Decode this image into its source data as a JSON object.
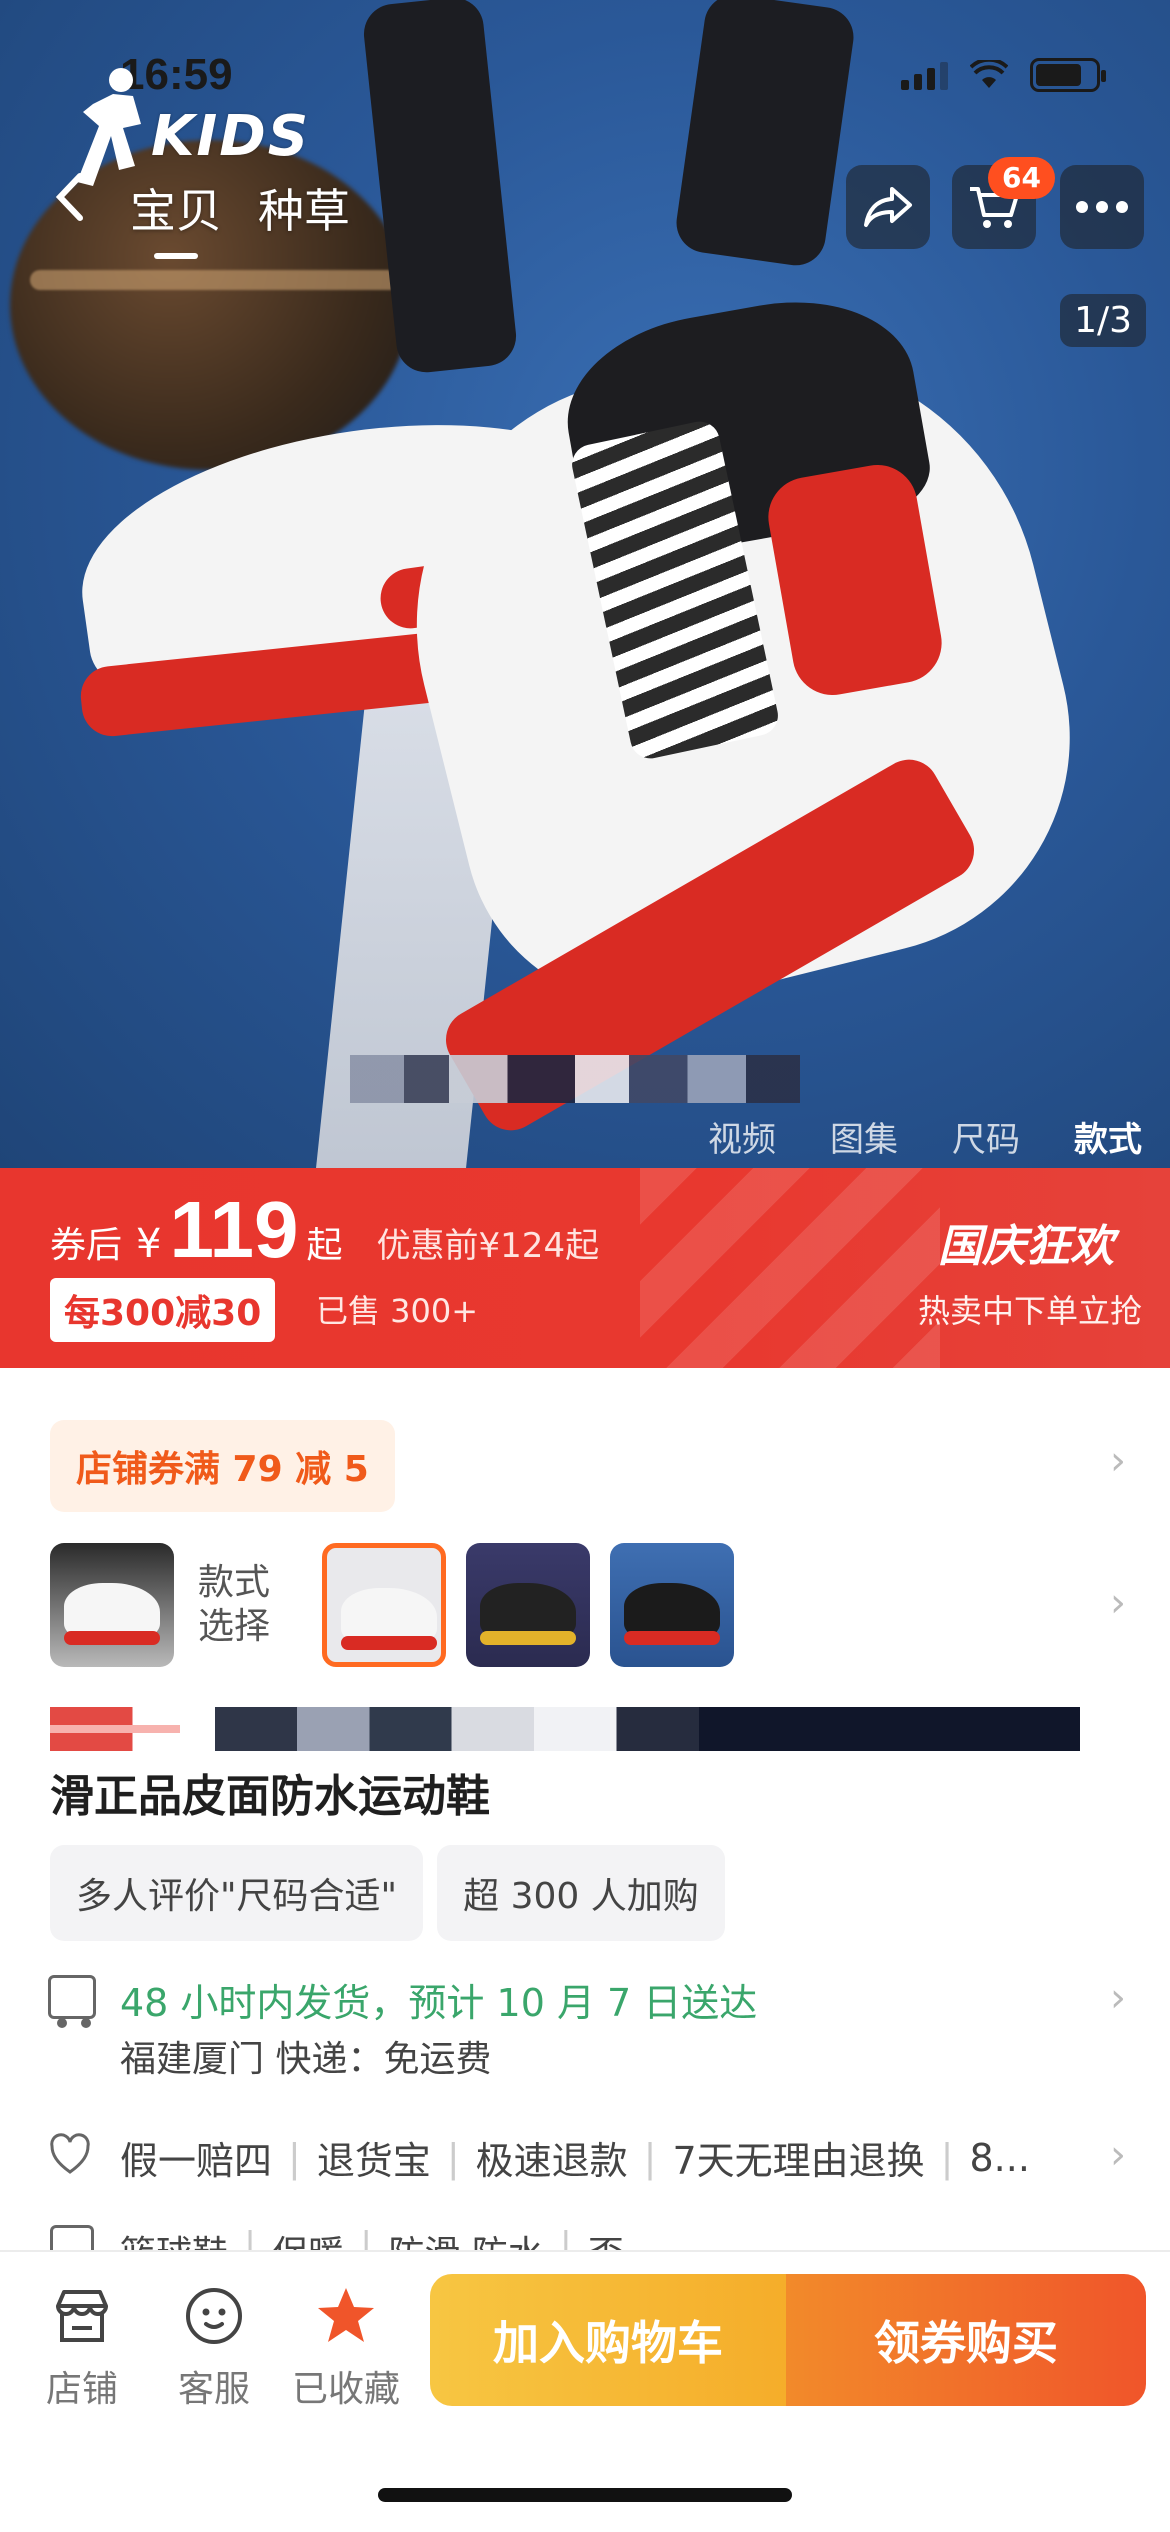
{
  "status_bar": {
    "time": "16:59"
  },
  "brand": {
    "logo_text": "KIDS"
  },
  "nav": {
    "back_icon": "chevron-left-icon",
    "tabs": [
      {
        "label": "宝贝",
        "active": true
      },
      {
        "label": "种草",
        "active": false
      }
    ],
    "cart_badge": "64",
    "share_icon": "share-arrow-icon",
    "cart_icon": "cart-icon",
    "more_icon": "more-dots-icon"
  },
  "gallery": {
    "pager": "1/3",
    "media_tabs": [
      {
        "label": "视频",
        "active": false
      },
      {
        "label": "图集",
        "active": false
      },
      {
        "label": "尺码",
        "active": false
      },
      {
        "label": "款式",
        "active": true
      }
    ]
  },
  "price": {
    "prefix": "券后",
    "currency": "¥",
    "value": "119",
    "suffix": "起",
    "original": "优惠前¥124起",
    "promo_tag": "每300减30",
    "sold": "已售 300+",
    "event_title": "国庆狂欢",
    "event_sub": "热卖中下单立抢"
  },
  "coupon": {
    "label": "店铺券满 79 减 5"
  },
  "variants": {
    "label": "款式选择",
    "count": 4,
    "selected_index": 1
  },
  "product": {
    "title": "滑正品皮面防水运动鞋"
  },
  "tags": [
    "多人评价\"尺码合适\"",
    "超 300 人加购"
  ],
  "shipping": {
    "main": "48 小时内发货，预计 10 月 7 日送达",
    "sub": "福建厦门  快递：免运费"
  },
  "guarantees": [
    "假一赔四",
    "退货宝",
    "极速退款",
    "7天无理由退换",
    "8..."
  ],
  "attributes": [
    "篮球鞋",
    "保暖",
    "防滑 防水",
    "否"
  ],
  "bottom_bar": {
    "store": "店铺",
    "service": "客服",
    "favorite": "已收藏",
    "add_to_cart": "加入购物车",
    "buy": "领券购买"
  },
  "colors": {
    "accent_red": "#e8362e",
    "accent_orange": "#f0552a",
    "cart_yellow": "#f7c642",
    "ship_green": "#3aa66b",
    "fav_star": "#f0552a"
  }
}
